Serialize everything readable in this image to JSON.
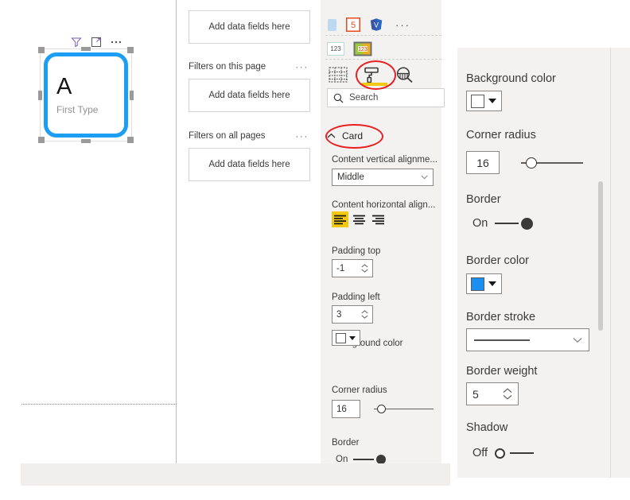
{
  "canvas": {
    "visual_header_icons": [
      "filter-icon",
      "focus-mode-icon",
      "more-options-icon"
    ],
    "card": {
      "value": "A",
      "label": "First Type"
    }
  },
  "filters_pane": {
    "sections": [
      {
        "title": "",
        "drop_placeholder": "Add data fields here",
        "ellipsis": "···"
      },
      {
        "title": "Filters on this page",
        "drop_placeholder": "Add data fields here",
        "ellipsis": "···"
      },
      {
        "title": "Filters on all pages",
        "drop_placeholder": "Add data fields here",
        "ellipsis": "···"
      }
    ]
  },
  "viz_pane": {
    "gallery_row1": [
      "card-visual-icon",
      "html-viewer-icon",
      "visio-visual-icon"
    ],
    "gallery_row1_more": "···",
    "gallery_row2": [
      "multi-row-card-icon",
      "kpi-card-icon"
    ],
    "tabs": [
      {
        "name": "fields-tab",
        "icon": "fields-table-icon",
        "selected": false
      },
      {
        "name": "format-tab",
        "icon": "paint-roller-icon",
        "selected": true
      },
      {
        "name": "analytics-tab",
        "icon": "magnifier-chart-icon",
        "selected": false
      }
    ],
    "search": {
      "placeholder": "Search",
      "icon": "search-icon"
    },
    "section": {
      "title": "Card",
      "chevron": "chevron-up-icon",
      "expanded": true
    },
    "settings": [
      {
        "key": "content_vertical_alignment",
        "label": "Content vertical alignme...",
        "type": "dropdown",
        "value": "Middle"
      },
      {
        "key": "content_horizontal_alignment",
        "label": "Content horizontal align...",
        "type": "align-buttons",
        "options": [
          "align-left-icon",
          "align-center-icon",
          "align-right-icon"
        ],
        "selected_index": 0
      },
      {
        "key": "padding_top",
        "label": "Padding top",
        "type": "spinner",
        "value": "-1"
      },
      {
        "key": "padding_left",
        "label": "Padding left",
        "type": "spinner",
        "value": "3"
      },
      {
        "key": "background_color",
        "label": "Background color",
        "type": "color",
        "value": "#ffffff"
      },
      {
        "key": "corner_radius",
        "label": "Corner radius",
        "type": "slider",
        "value": "16"
      },
      {
        "key": "border",
        "label": "Border",
        "type": "toggle",
        "value": "On"
      }
    ]
  },
  "right_panel": {
    "settings": [
      {
        "key": "background_color",
        "label": "Background color",
        "type": "color",
        "value": "#ffffff"
      },
      {
        "key": "corner_radius",
        "label": "Corner radius",
        "type": "slider",
        "value": "16"
      },
      {
        "key": "border",
        "label": "Border",
        "type": "toggle",
        "value": "On"
      },
      {
        "key": "border_color",
        "label": "Border color",
        "type": "color",
        "value": "#1b8ef2"
      },
      {
        "key": "border_stroke",
        "label": "Border stroke",
        "type": "dropdown",
        "value": "solid-line"
      },
      {
        "key": "border_weight",
        "label": "Border weight",
        "type": "spinner",
        "value": "5"
      },
      {
        "key": "shadow",
        "label": "Shadow",
        "type": "toggle",
        "value": "Off"
      }
    ]
  },
  "colors": {
    "accent_blue": "#1b9ef3",
    "highlight_yellow": "#f2c811",
    "annotation_red": "#e8201f",
    "panel_bg": "#f3f2f1"
  },
  "annotations": [
    {
      "name": "format-tab-highlight-ellipse",
      "shape": "ellipse"
    },
    {
      "name": "card-section-highlight-ellipse",
      "shape": "ellipse"
    }
  ]
}
